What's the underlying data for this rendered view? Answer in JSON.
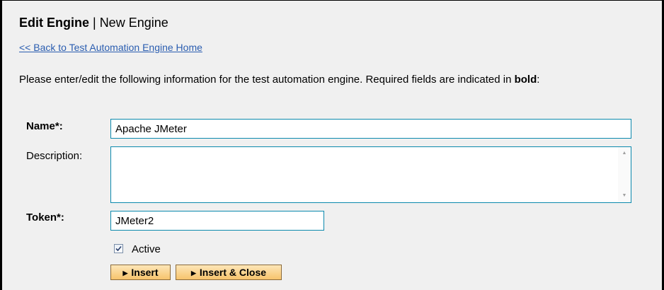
{
  "header": {
    "title_bold": "Edit Engine",
    "title_separator": " | ",
    "title_rest": "New Engine"
  },
  "nav": {
    "back_link": "<< Back to Test Automation Engine Home"
  },
  "instructions": {
    "text_before": "Please enter/edit the following information for the test automation engine. Required fields are indicated in ",
    "bold_word": "bold",
    "text_after": ":"
  },
  "form": {
    "name_label": "Name*:",
    "name_value": "Apache JMeter",
    "description_label": "Description:",
    "description_value": "",
    "token_label": "Token*:",
    "token_value": "JMeter2",
    "active_label": "Active",
    "active_checked": true
  },
  "buttons": {
    "insert": "Insert",
    "insert_close": "Insert & Close"
  },
  "icons": {
    "button_arrow": "triangle-right-icon",
    "checkbox_check": "check-icon",
    "scroll_up": "scroll-up-arrow-icon",
    "scroll_down": "scroll-down-arrow-icon"
  },
  "colors": {
    "background": "#f0f0f0",
    "link": "#2a5db0",
    "input_border": "#0b89ad",
    "button_bg": "#f7c46c"
  }
}
